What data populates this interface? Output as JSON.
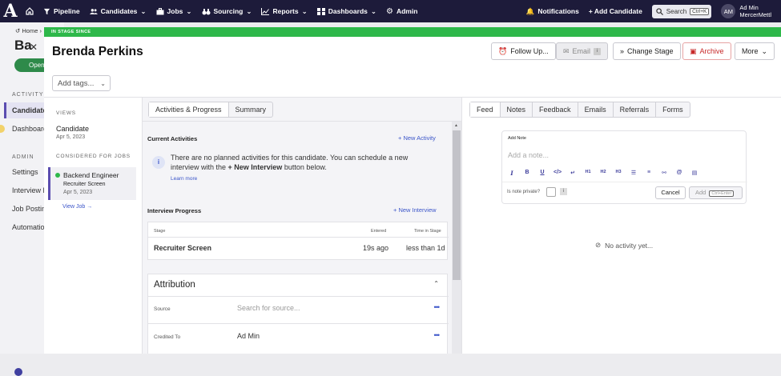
{
  "topbar": {
    "logo": "A",
    "nav": [
      {
        "icon": "home-icon",
        "label": ""
      },
      {
        "icon": "filter-icon",
        "label": "Pipeline"
      },
      {
        "icon": "people-icon",
        "label": "Candidates"
      },
      {
        "icon": "briefcase-icon",
        "label": "Jobs"
      },
      {
        "icon": "binoculars-icon",
        "label": "Sourcing"
      },
      {
        "icon": "chart-icon",
        "label": "Reports"
      },
      {
        "icon": "dashboard-icon",
        "label": "Dashboards"
      },
      {
        "icon": "gear-icon",
        "label": "Admin"
      }
    ],
    "notifications": "Notifications",
    "add_candidate": "+ Add Candidate",
    "search_label": "Search",
    "search_kbd": "Ctrl+K",
    "avatar_initials": "AM",
    "user_name": "Ad Min",
    "user_org": "MercerMettl"
  },
  "background": {
    "crumb": "Home",
    "title": "Ba",
    "pill": "Open",
    "activity_label": "ACTIVITY",
    "candidates": "Candidates",
    "dashboard": "Dashboard",
    "admin_label": "ADMIN",
    "settings": "Settings",
    "interview": "Interview P",
    "job_posting": "Job Posting",
    "automation": "Automation"
  },
  "modal": {
    "banner": "IN STAGE SINCE",
    "candidate_name": "Brenda Perkins",
    "buttons": {
      "follow_up": "Follow Up...",
      "email": "Email",
      "email_badge": "i",
      "change_stage": "Change Stage",
      "archive": "Archive",
      "more": "More"
    },
    "add_tags": "Add tags..."
  },
  "left": {
    "views_label": "VIEWS",
    "view_name": "Candidate",
    "view_date": "Apr 5, 2023",
    "considered_label": "CONSIDERED FOR JOBS",
    "job_title": "Backend Engineer",
    "job_stage": "Recruiter Screen",
    "job_date": "Apr 5, 2023",
    "view_job": "View Job →"
  },
  "middle": {
    "tabs": [
      "Activities & Progress",
      "Summary"
    ],
    "current_activities": "Current Activities",
    "new_activity": "+ New Activity",
    "info_text_1": "There are no planned activities for this candidate. You can schedule a new interview with the ",
    "info_bold": "+ New Interview",
    "info_text_2": " button below.",
    "learn_more": "Learn more",
    "interview_progress": "Interview Progress",
    "new_interview": "+ New Interview",
    "table_headers": {
      "stage": "Stage",
      "entered": "Entered",
      "time": "Time in Stage"
    },
    "table_row": {
      "stage": "Recruiter Screen",
      "entered": "19s ago",
      "time": "less than 1d"
    },
    "attribution_title": "Attribution",
    "source_label": "Source",
    "source_placeholder": "Search for source...",
    "credited_label": "Credited To",
    "credited_value": "Ad Min"
  },
  "right": {
    "tabs": [
      "Feed",
      "Notes",
      "Feedback",
      "Emails",
      "Referrals",
      "Forms"
    ],
    "add_note_label": "Add Note",
    "note_placeholder": "Add a note...",
    "format_buttons": [
      "I",
      "B",
      "U",
      "</>",
      "↵",
      "H1",
      "H2",
      "H3",
      "☰",
      "≡",
      "⚯",
      "@",
      "▤"
    ],
    "private_label": "Is note private?",
    "cancel": "Cancel",
    "add": "Add",
    "add_kbd": "Ctrl+Enter",
    "no_activity": "No activity yet..."
  },
  "colors": {
    "topbar": "#1d1b3a",
    "banner": "#2eb84a",
    "accent": "#5b4db0",
    "link": "#3b55c9",
    "archive": "#c72828"
  }
}
